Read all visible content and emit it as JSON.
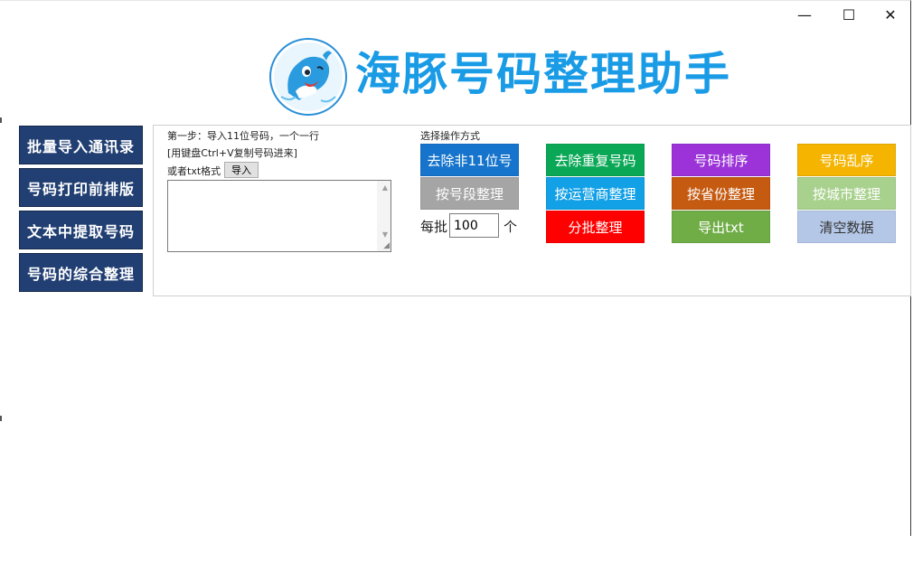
{
  "window": {
    "minimize_glyph": "—",
    "maximize_glyph": "☐",
    "close_glyph": "✕"
  },
  "header": {
    "title": "海豚号码整理助手",
    "logo_icon": "dolphin-logo-icon"
  },
  "nav": {
    "items": [
      {
        "label": "批量导入通讯录"
      },
      {
        "label": "号码打印前排版"
      },
      {
        "label": "文本中提取号码"
      },
      {
        "label": "号码的综合整理"
      }
    ]
  },
  "import": {
    "step_label": "第一步：导入11位号码，一个一行",
    "paste_hint": "[用键盘Ctrl+V复制号码进来]",
    "or_txt_label": "或者txt格式",
    "import_button": "导入"
  },
  "operations": {
    "header": "选择操作方式",
    "buttons": [
      {
        "label": "去除非11位号",
        "color": "#1674cc"
      },
      {
        "label": "去除重复号码",
        "color": "#0aa856"
      },
      {
        "label": "号码排序",
        "color": "#9b33d8"
      },
      {
        "label": "号码乱序",
        "color": "#f4b400"
      },
      {
        "label": "按号段整理",
        "color": "#a5a5a5"
      },
      {
        "label": "按运营商整理",
        "color": "#12a0e6"
      },
      {
        "label": "按省份整理",
        "color": "#c55a11"
      },
      {
        "label": "按城市整理",
        "color": "#a9d18e"
      },
      {
        "label": "分批整理",
        "color": "#ff0000"
      },
      {
        "label": "导出txt",
        "color": "#70ad47"
      },
      {
        "label": "清空数据",
        "color": "#b4c7e7"
      }
    ],
    "batch_prefix": "每批",
    "batch_value": "100",
    "batch_unit": "个"
  },
  "colors": {
    "nav_bg": "#213f72",
    "title_color": "#1a9be6"
  }
}
